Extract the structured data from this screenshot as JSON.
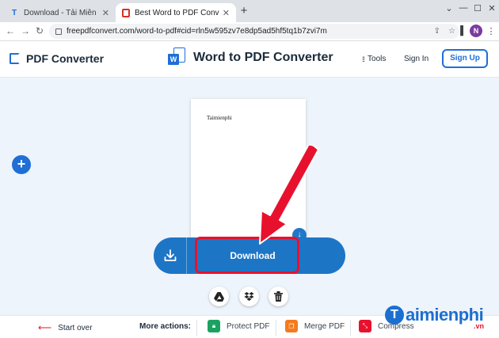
{
  "browser": {
    "tabs": [
      {
        "title": "Download - Tải Miễn Phí VN - Ph",
        "active": false
      },
      {
        "title": "Best Word to PDF Converter: Co",
        "active": true
      }
    ],
    "url": "freepdfconvert.com/word-to-pdf#cid=rln5w595zv7e8dp5ad5hf5tq1b7zvi7m",
    "profile_initial": "N"
  },
  "header": {
    "logo_text": "PDF Converter",
    "tool_title": "Word to PDF Converter",
    "word_badge": "W",
    "tools_label": "Tools",
    "signin_label": "Sign In",
    "signup_label": "Sign Up"
  },
  "workspace": {
    "add_label": "+",
    "preview_text": "Taimienphi",
    "download_label": "Download"
  },
  "bottom": {
    "start_over": "Start over",
    "more_actions": "More actions:",
    "actions": [
      {
        "label": "Protect PDF",
        "color": "#1aa260"
      },
      {
        "label": "Merge PDF",
        "color": "#f47b20"
      },
      {
        "label": "Compress",
        "color": "#e8112d"
      }
    ]
  },
  "colors": {
    "brand": "#1f6fd6",
    "download_bar": "#1d75c6",
    "highlight": "#e8112d",
    "background": "#eef4fb"
  },
  "watermark": {
    "brand": "aimienphi",
    "mark": "T",
    "domain": ".vn"
  }
}
